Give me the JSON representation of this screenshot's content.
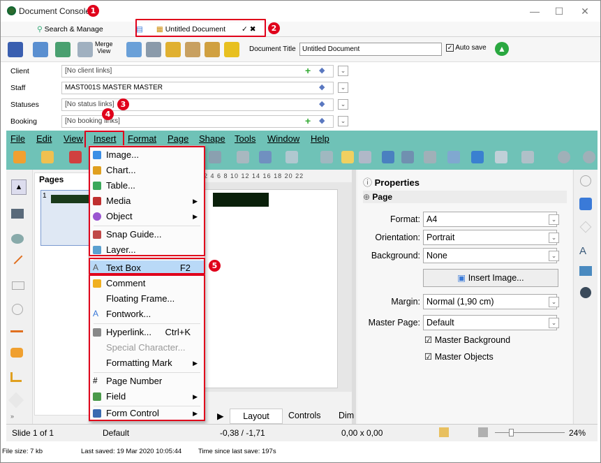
{
  "window": {
    "title": "Document Console",
    "controls": {
      "minimize": "—",
      "maximize": "☐",
      "close": "✕"
    }
  },
  "tabs": [
    {
      "label": "Search & Manage"
    },
    {
      "label": "Untitled Document"
    }
  ],
  "toolbar": {
    "merge_view_label_1": "Merge",
    "merge_view_label_2": "View",
    "doc_title_label": "Document Title",
    "doc_title_value": "Untitled Document",
    "auto_save_label": "Auto save"
  },
  "fields": [
    {
      "label": "Client",
      "value": "[No client links]"
    },
    {
      "label": "Staff",
      "value": "MAST001S MASTER MASTER"
    },
    {
      "label": "Statuses",
      "value": "[No status links]"
    },
    {
      "label": "Booking",
      "value": "[No booking links]"
    }
  ],
  "menubar": {
    "items": [
      "File",
      "Edit",
      "View",
      "Insert",
      "Format",
      "Page",
      "Shape",
      "Tools",
      "Window",
      "Help"
    ]
  },
  "insert_menu": {
    "items": [
      {
        "label": "Image...",
        "color": "#3a8ee6"
      },
      {
        "label": "Chart...",
        "color": "#e0a020"
      },
      {
        "label": "Table...",
        "color": "#3aa85a"
      },
      {
        "label": "Media",
        "submenu": true,
        "color": "#c03030"
      },
      {
        "label": "Object",
        "submenu": true,
        "color": "#9a55d0"
      },
      {
        "label": "Snap Guide...",
        "color": "#c04848"
      },
      {
        "label": "Layer...",
        "color": "#5aa0d0"
      },
      {
        "label": "Text Box",
        "shortcut": "F2",
        "color": "#555555"
      },
      {
        "label": "Comment",
        "color": "#f0b020"
      },
      {
        "label": "Floating Frame...",
        "color": ""
      },
      {
        "label": "Fontwork...",
        "color": "#3a78d8"
      },
      {
        "label": "Hyperlink...",
        "shortcut": "Ctrl+K",
        "color": "#666666"
      },
      {
        "label": "Special Character...",
        "disabled": true
      },
      {
        "label": "Formatting Mark",
        "submenu": true
      },
      {
        "label": "Page Number",
        "color": "#333333"
      },
      {
        "label": "Field",
        "submenu": true,
        "color": "#4a9a4a"
      },
      {
        "label": "Form Control",
        "submenu": true,
        "color": "#3a6ab0"
      }
    ]
  },
  "pages_panel": {
    "title": "Pages",
    "page_number": "1"
  },
  "ruler": {
    "ticks": "2  4  6  8  10  12  14  16  18  20  22"
  },
  "bottom_tabs": {
    "layout": "Layout",
    "controls": "Controls",
    "dim": "Dim"
  },
  "properties": {
    "title": "Properties",
    "section": "Page",
    "format_label": "Format:",
    "format_value": "A4",
    "orientation_label": "Orientation:",
    "orientation_value": "Portrait",
    "background_label": "Background:",
    "background_value": "None",
    "insert_image": "Insert Image...",
    "margin_label": "Margin:",
    "margin_value": "Normal (1,90 cm)",
    "master_page_label": "Master Page:",
    "master_page_value": "Default",
    "master_background": "Master Background",
    "master_objects": "Master Objects"
  },
  "statusbar": {
    "slide": "Slide 1 of 1",
    "layout": "Default",
    "position": "-0,38 / -1,71",
    "size": "0,00 x 0,00",
    "zoom": "24%"
  },
  "footer": {
    "file_size": "File size: 7 kb",
    "last_saved": "Last saved: 19 Mar 2020 10:05:44",
    "since_save": "Time since last save: 197s"
  },
  "annotations": [
    "1",
    "2",
    "3",
    "4",
    "5"
  ],
  "colors": {
    "accent_teal": "#6fc2b7",
    "annotation_red": "#e0001b",
    "menu_highlight": "#b9d9f7"
  }
}
